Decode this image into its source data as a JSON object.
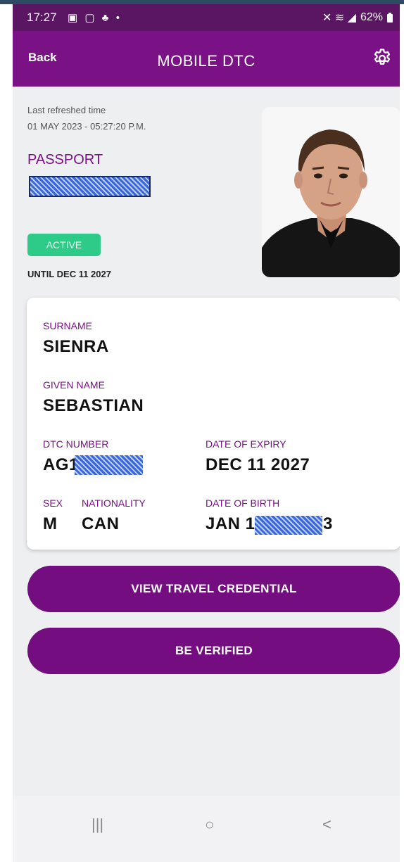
{
  "status_bar": {
    "time": "17:27",
    "left_icons": "▣ ▢ ♣ •",
    "right_icons": "✕ ≋ ◢",
    "battery": "62%"
  },
  "app_bar": {
    "back_label": "Back",
    "title": "MOBILE DTC",
    "settings_icon": "gear-icon"
  },
  "credential": {
    "last_refreshed_label": "Last refreshed time",
    "last_refreshed_value": "01 MAY 2023 - 05:27:20 P.M.",
    "document_type": "PASSPORT",
    "document_number": "",
    "status": "ACTIVE",
    "valid_until": "UNTIL DEC 11 2027"
  },
  "card": {
    "surname_label": "SURNAME",
    "surname": "SIENRA",
    "given_name_label": "GIVEN NAME",
    "given_name": "SEBASTIAN",
    "dtc_number_label": "DTC NUMBER",
    "dtc_number": "AG1",
    "date_of_expiry_label": "DATE OF EXPIRY",
    "date_of_expiry": "DEC 11 2027",
    "sex_label": "SEX",
    "sex": "M",
    "nationality_label": "NATIONALITY",
    "nationality": "CAN",
    "date_of_birth_label": "DATE OF BIRTH",
    "date_of_birth_start": "JAN 1",
    "date_of_birth_end": "3"
  },
  "actions": {
    "view_label": "VIEW TRAVEL CREDENTIAL",
    "verify_label": "BE VERIFIED"
  },
  "nav_bar": {
    "recents": "|||",
    "home": "○",
    "back": "<"
  },
  "colors": {
    "brand": "#7a1185",
    "status_bar": "#5a1563",
    "button": "#730d80",
    "active": "#2ecb88"
  }
}
